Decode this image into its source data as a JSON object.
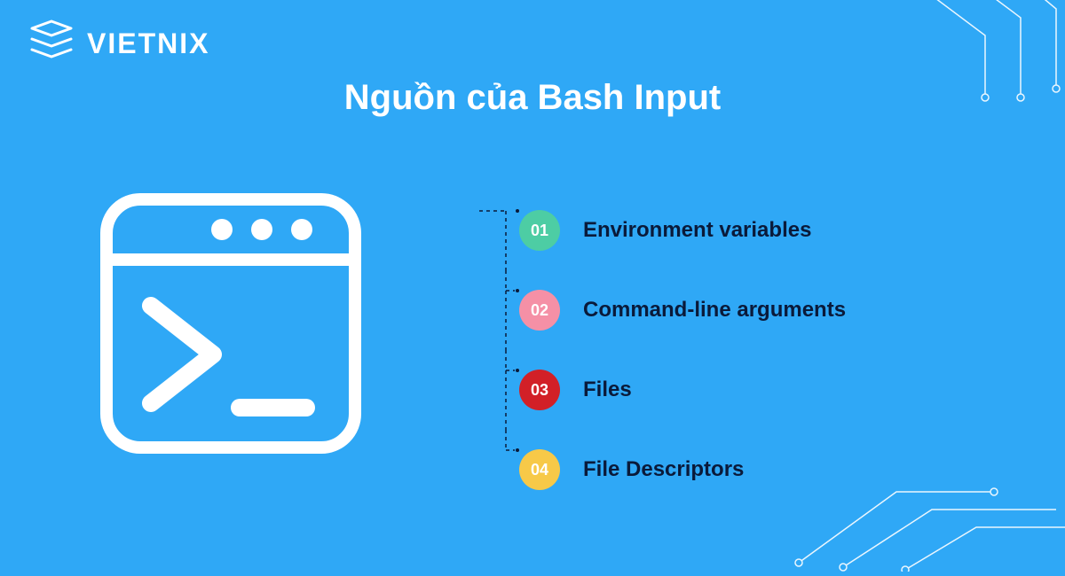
{
  "brand": {
    "name": "VIETNIX"
  },
  "title": "Nguồn của Bash Input",
  "items": [
    {
      "num": "01",
      "label": "Environment variables",
      "color": "#4DCDA4"
    },
    {
      "num": "02",
      "label": "Command-line arguments",
      "color": "#F590A6"
    },
    {
      "num": "03",
      "label": "Files",
      "color": "#D22027"
    },
    {
      "num": "04",
      "label": "File Descriptors",
      "color": "#F7C948"
    }
  ]
}
